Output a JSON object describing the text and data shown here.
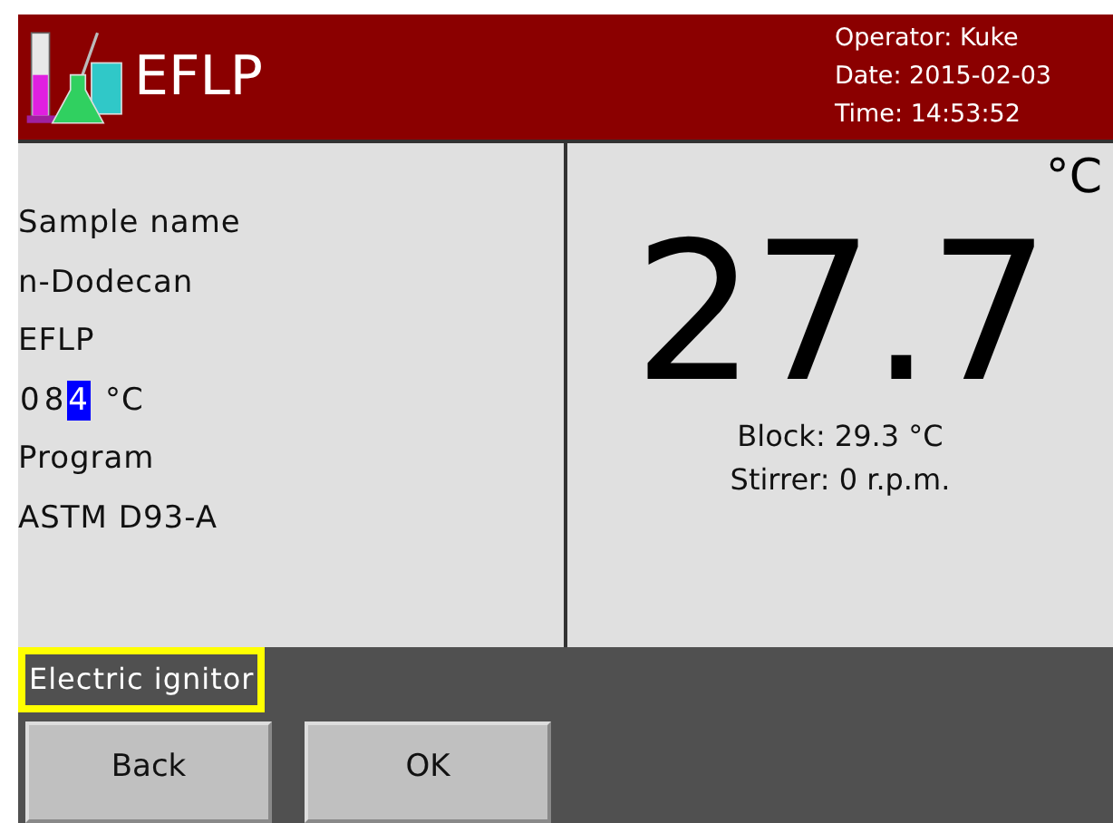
{
  "header": {
    "title": "EFLP",
    "operator": "Operator: Kuke",
    "date": "Date: 2015-02-03",
    "time": "Time: 14:53:52"
  },
  "left_panel": {
    "sample_label": "Sample name",
    "sample_value": "n-Dodecan",
    "eflp_label": "EFLP",
    "eflp_digits": [
      {
        "text": "0",
        "selected": false
      },
      {
        "text": "8",
        "selected": false
      },
      {
        "text": "4",
        "selected": true
      }
    ],
    "eflp_unit": "°C",
    "program_label": "Program",
    "program_value": "ASTM D93-A"
  },
  "right_panel": {
    "unit": "°C",
    "temperature": "27.7",
    "block": "Block: 29.3 °C",
    "stirrer": "Stirrer: 0 r.p.m."
  },
  "status": {
    "text": "Electric ignitor"
  },
  "buttons": [
    "Back",
    "OK"
  ]
}
